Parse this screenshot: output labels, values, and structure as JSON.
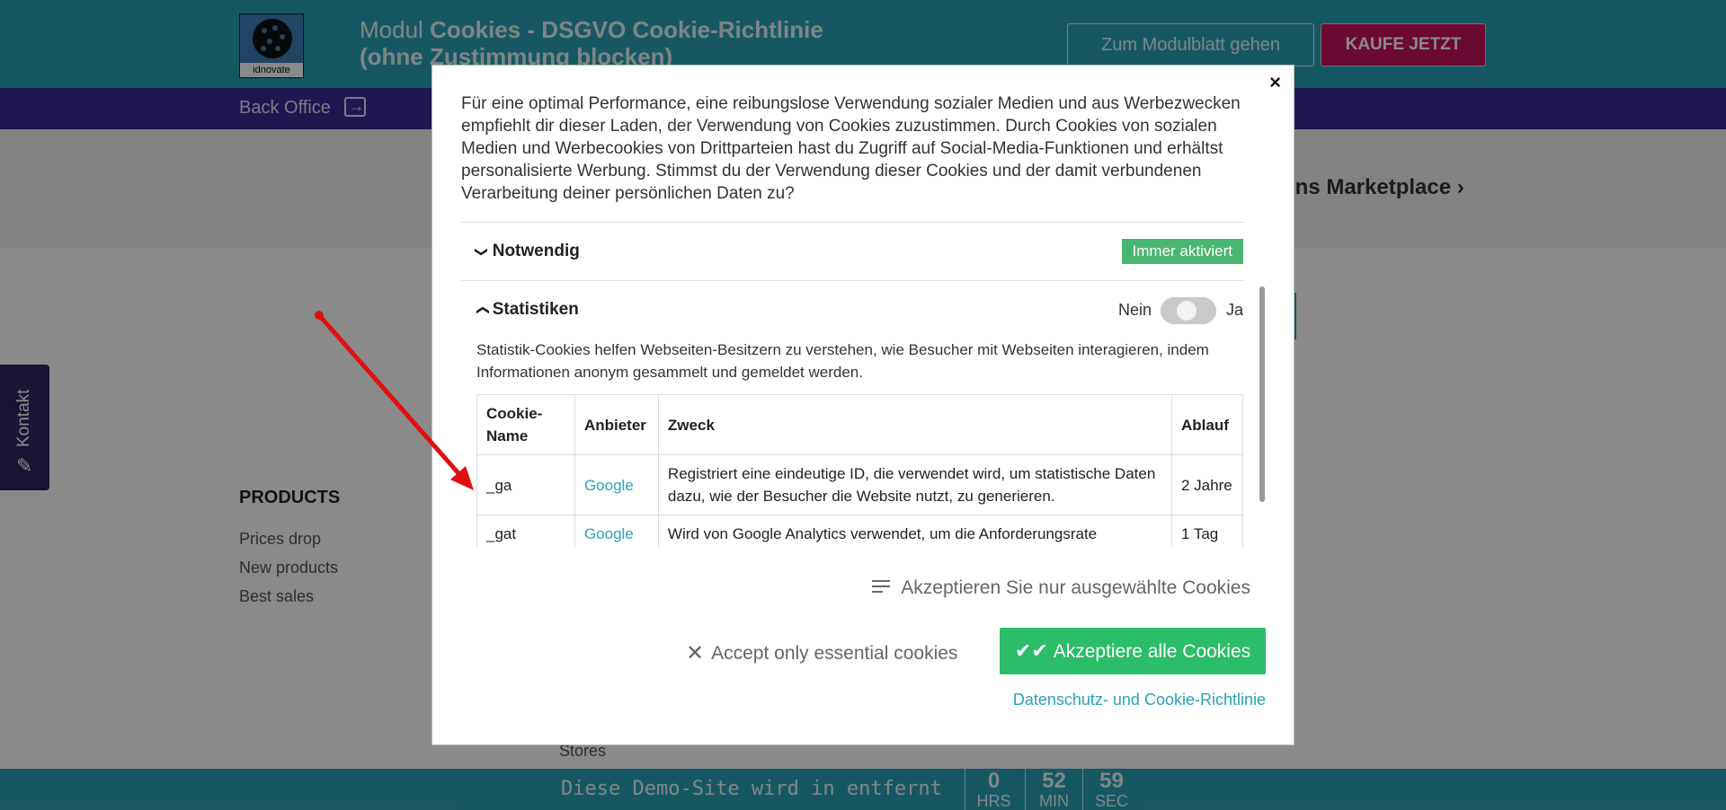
{
  "header": {
    "logo_text": "idnovate",
    "module_prefix": "Modul",
    "module_title": "Cookies - DSGVO Cookie-Richtlinie (ohne Zustimmung blocken)",
    "modulblatt_button": "Zum Modulblatt gehen",
    "kaufe_button": "KAUFE JETZT"
  },
  "nav": {
    "backoffice": "Back Office"
  },
  "page": {
    "marketplace": "ons Marketplace",
    "marketplace_chevron": "›",
    "products_title": "PRODUCTS",
    "products_links": [
      "Prices drop",
      "New products",
      "Best sales"
    ],
    "kontakt": "Kontakt",
    "obscured_footer_text": "Stores"
  },
  "demo_bar": {
    "text": "Diese Demo-Site wird in entfernt",
    "timer": [
      {
        "value": "0",
        "unit": "HRS"
      },
      {
        "value": "52",
        "unit": "MIN"
      },
      {
        "value": "59",
        "unit": "SEC"
      }
    ]
  },
  "modal": {
    "close": "×",
    "intro": "Für eine optimal Performance, eine reibungslose Verwendung sozialer Medien und aus Werbezwecken empfiehlt dir dieser Laden, der Verwendung von Cookies zuzustimmen. Durch Cookies von sozialen Medien und Werbecookies von Drittparteien hast du Zugriff auf Social-Media-Funktionen und erhältst personalisierte Werbung. Stimmst du der Verwendung dieser Cookies und der damit verbundenen Verarbeitung deiner persönlichen Daten zu?",
    "sections": {
      "notwendig": {
        "title": "Notwendig",
        "badge": "Immer aktiviert"
      },
      "statistiken": {
        "title": "Statistiken",
        "toggle_off": "Nein",
        "toggle_on": "Ja",
        "toggle_state": "off",
        "description": "Statistik-Cookies helfen Webseiten-Besitzern zu verstehen, wie Besucher mit Webseiten interagieren, indem Informationen anonym gesammelt und gemeldet werden.",
        "table": {
          "headers": [
            "Cookie-Name",
            "Anbieter",
            "Zweck",
            "Ablauf"
          ],
          "rows": [
            [
              "_ga",
              "Google",
              "Registriert eine eindeutige ID, die verwendet wird, um statistische Daten dazu, wie der Besucher die Website nutzt, zu generieren.",
              "2 Jahre"
            ],
            [
              "_gat",
              "Google",
              "Wird von Google Analytics verwendet, um die Anforderungsrate",
              "1 Tag"
            ]
          ]
        }
      }
    },
    "accept_selected": "Akzeptieren Sie nur ausgewählte Cookies",
    "accept_essential": "Accept only essential cookies",
    "accept_all": "Akzeptiere alle Cookies",
    "privacy_link": "Datenschutz- und Cookie-Richtlinie"
  },
  "colors": {
    "teal": "#2aa3b5",
    "purple": "#3b2a93",
    "magenta": "#c8125f",
    "green": "#2bbd67",
    "annotation_arrow": "#e01010"
  }
}
